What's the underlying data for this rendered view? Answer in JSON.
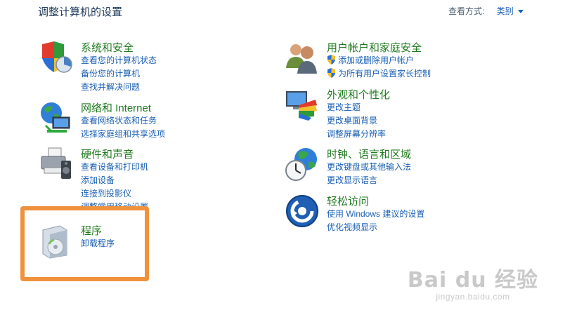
{
  "header": {
    "title": "调整计算机的设置",
    "view_by_label": "查看方式:",
    "view_by_value": "类别"
  },
  "categories": [
    {
      "title": "系统和安全",
      "links": [
        "查看您的计算机状态",
        "备份您的计算机",
        "查找并解决问题"
      ]
    },
    {
      "title": "网络和 Internet",
      "links": [
        "查看网络状态和任务",
        "选择家庭组和共享选项"
      ]
    },
    {
      "title": "硬件和声音",
      "links": [
        "查看设备和打印机",
        "添加设备",
        "连接到投影仪",
        "调整常用移动设置"
      ]
    },
    {
      "title": "程序",
      "links": [
        "卸载程序"
      ]
    },
    {
      "title": "用户帐户和家庭安全",
      "links": [
        "添加或删除用户帐户",
        "为所有用户设置家长控制"
      ]
    },
    {
      "title": "外观和个性化",
      "links": [
        "更改主题",
        "更改桌面背景",
        "调整屏幕分辨率"
      ]
    },
    {
      "title": "时钟、语言和区域",
      "links": [
        "更改键盘或其他输入法",
        "更改显示语言"
      ]
    },
    {
      "title": "轻松访问",
      "links": [
        "使用 Windows 建议的设置",
        "优化视频显示"
      ]
    }
  ],
  "icons": {
    "system_security": "shield-chart-icon",
    "network": "globe-network-icon",
    "hardware": "printer-speaker-icon",
    "programs": "software-box-icon",
    "user_accounts": "users-icon",
    "appearance": "monitor-palette-icon",
    "clock_language": "clock-globe-icon",
    "ease_of_access": "ease-of-access-icon",
    "uac": "uac-shield-icon"
  },
  "watermark": {
    "logo": "Bai du 经验",
    "url": "jingyan.baidu.com"
  },
  "colors": {
    "title_green": "#1f7a1f",
    "link_blue": "#1a5fb4",
    "highlight_orange": "#f0913e"
  }
}
